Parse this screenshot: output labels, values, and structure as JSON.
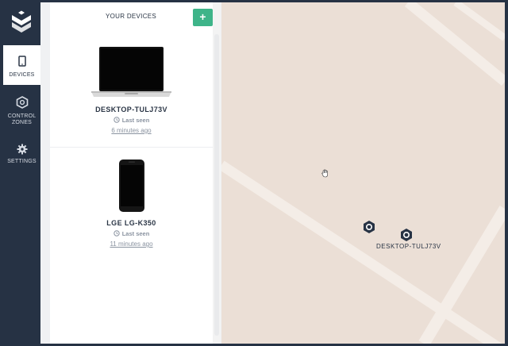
{
  "nav": {
    "items": [
      {
        "label": "DEVICES",
        "icon": "tablet-icon"
      },
      {
        "label": "CONTROL",
        "label2": "ZONES",
        "icon": "zone-icon"
      },
      {
        "label": "SETTINGS",
        "icon": "gear-icon"
      }
    ]
  },
  "panel": {
    "title": "YOUR DEVICES",
    "add_label": "+",
    "devices": [
      {
        "name": "DESKTOP-TULJ73V",
        "status": "Last seen",
        "time": "6 minutes ago",
        "icon": "laptop-icon"
      },
      {
        "name": "LGE LG-K350",
        "status": "Last seen",
        "time": "11 minutes ago",
        "icon": "phone-icon"
      }
    ]
  },
  "map": {
    "marker_label": "DESKTOP-TULJ73V",
    "background": "#ebdfd6",
    "road_color": "#f4ede7"
  },
  "colors": {
    "sidebar": "#263244",
    "accent": "#3eb489"
  }
}
